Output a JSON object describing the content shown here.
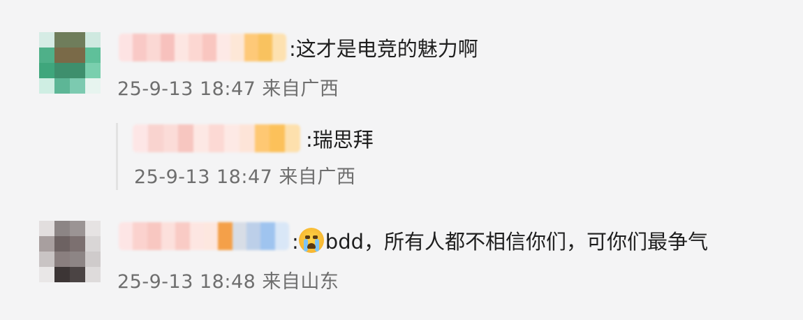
{
  "comments": [
    {
      "text": ":这才是电竞的魅力啊",
      "date": "25-9-13",
      "time": "18:47",
      "location": "来自广西",
      "avatar_colors": [
        "#d6ece5",
        "#6f7d5b",
        "#6f7d5b",
        "#cfe9e0",
        "#4fb089",
        "#7a6a48",
        "#7a6a48",
        "#5fc09a",
        "#3fa67c",
        "#3e8f6d",
        "#3e8f6d",
        "#7acfae",
        "#cfeee3",
        "#5db696",
        "#7ccab0",
        "#e7f4ef"
      ],
      "name_blur_colors": [
        "#fde3e3",
        "#f9c9c6",
        "#fbd8d4",
        "#f7c1bd",
        "#fde6e2",
        "#fcd7d2",
        "#f9c6c0",
        "#fde9e6",
        "#fde7d7",
        "#fec978",
        "#f9c25f",
        "#fde1b0"
      ]
    },
    {
      "text": ":瑞思拜",
      "date": "25-9-13",
      "time": "18:47",
      "location": "来自广西",
      "name_blur_colors": [
        "#fde6e6",
        "#f9d3cf",
        "#fbdcd8",
        "#f7c6c0",
        "#fde8e4",
        "#fcd9d4",
        "#fde9e5",
        "#fde4d8",
        "#fec873",
        "#fcc15a",
        "#fde0ad"
      ]
    },
    {
      "text": "bdd，所有人都不相信你们，可你们最争气",
      "text_prefix": ":",
      "emoji": "crying-face-icon",
      "date": "25-9-13",
      "time": "18:48",
      "location": "来自山东",
      "avatar_colors": [
        "#e2dede",
        "#8c8585",
        "#9b9494",
        "#e6e3e3",
        "#a89f9f",
        "#6d6262",
        "#7c7070",
        "#d9d6d6",
        "#c9c4c4",
        "#8a7f7f",
        "#8d8585",
        "#cfcbcb",
        "#e9e7e7",
        "#3c3535",
        "#4b4444",
        "#dedbdb"
      ],
      "name_blur_colors": [
        "#fde5e5",
        "#fbd2ce",
        "#f8c7c1",
        "#fce0dc",
        "#f9cbc5",
        "#fde6e2",
        "#fde7df",
        "#f4a049",
        "#d7dde6",
        "#bccfe9",
        "#9fc4ef",
        "#d9e7f7"
      ]
    }
  ]
}
